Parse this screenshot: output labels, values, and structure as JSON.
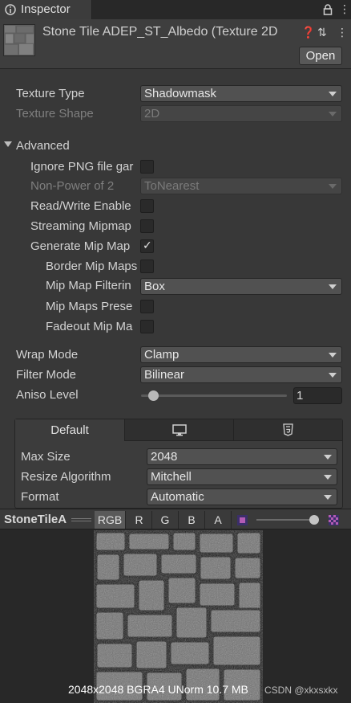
{
  "window": {
    "tab_title": "Inspector"
  },
  "header": {
    "title": "Stone Tile ADEP_ST_Albedo (Texture 2D",
    "open_label": "Open"
  },
  "properties": {
    "texture_type": {
      "label": "Texture Type",
      "value": "Shadowmask"
    },
    "texture_shape": {
      "label": "Texture Shape",
      "value": "2D"
    }
  },
  "advanced": {
    "label": "Advanced",
    "ignore_png": {
      "label": "Ignore PNG file gar",
      "checked": false
    },
    "npot": {
      "label": "Non-Power of 2",
      "value": "ToNearest"
    },
    "read_write": {
      "label": "Read/Write Enable",
      "checked": false
    },
    "streaming_mip": {
      "label": "Streaming Mipmap",
      "checked": false
    },
    "generate_mip": {
      "label": "Generate Mip Map",
      "checked": true
    },
    "border_mip": {
      "label": "Border Mip Maps",
      "checked": false
    },
    "mip_filter": {
      "label": "Mip Map Filterin",
      "value": "Box"
    },
    "mip_preserve": {
      "label": "Mip Maps Prese",
      "checked": false
    },
    "fadeout_mip": {
      "label": "Fadeout Mip Ma",
      "checked": false
    },
    "check_mark": "✓"
  },
  "sampling": {
    "wrap_mode": {
      "label": "Wrap Mode",
      "value": "Clamp"
    },
    "filter_mode": {
      "label": "Filter Mode",
      "value": "Bilinear"
    },
    "aniso": {
      "label": "Aniso Level",
      "value": "1"
    }
  },
  "platform": {
    "tabs": [
      {
        "label": "Default",
        "icon": ""
      },
      {
        "label": "",
        "icon": "monitor-icon"
      },
      {
        "label": "",
        "icon": "html5-icon"
      }
    ],
    "max_size": {
      "label": "Max Size",
      "value": "2048"
    },
    "resize_algorithm": {
      "label": "Resize Algorithm",
      "value": "Mitchell"
    },
    "format": {
      "label": "Format",
      "value": "Automatic"
    }
  },
  "preview": {
    "name": "StoneTileA",
    "channels": [
      "RGB",
      "R",
      "G",
      "B",
      "A"
    ],
    "active_channel": "RGB",
    "info": "2048x2048  BGRA4 UNorm    10.7 MB",
    "watermark": "CSDN @xkxsxkx",
    "mip_level": 0.9
  },
  "colors": {
    "panel_bg": "#383838",
    "field_bg": "#515151",
    "preview_bg": "#282828"
  }
}
